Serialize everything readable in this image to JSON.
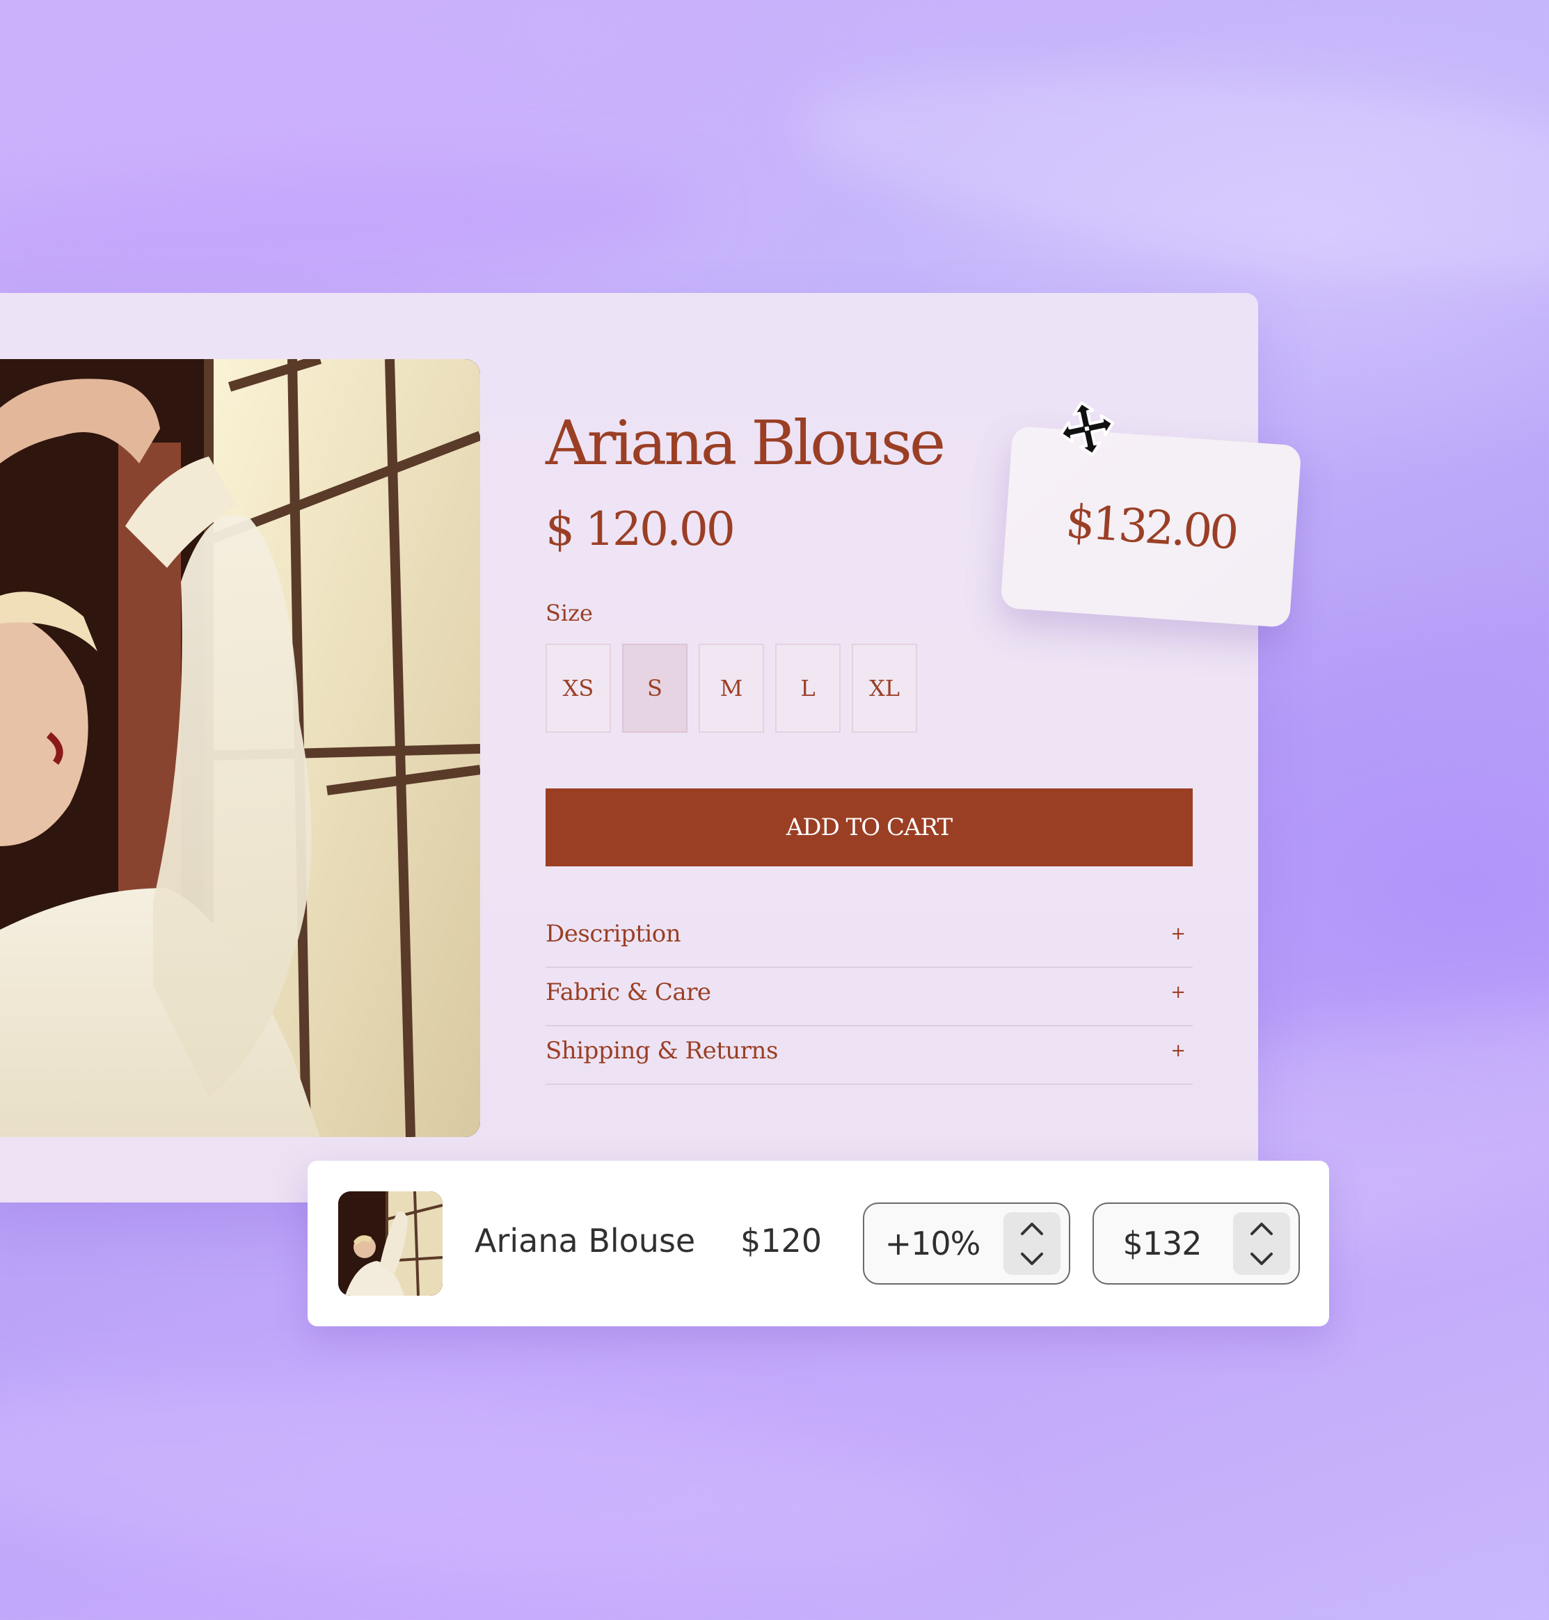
{
  "product": {
    "title": "Ariana Blouse",
    "price": "$ 120.00",
    "size_label": "Size",
    "sizes": [
      "XS",
      "S",
      "M",
      "L",
      "XL"
    ],
    "selected_size": "S",
    "add_to_cart_label": "ADD TO CART",
    "accordion": [
      {
        "label": "Description",
        "icon": "plus-icon",
        "toggle": "+"
      },
      {
        "label": "Fabric & Care",
        "icon": "plus-icon",
        "toggle": "+"
      },
      {
        "label": "Shipping & Returns",
        "icon": "plus-icon",
        "toggle": "+"
      }
    ]
  },
  "price_tag": {
    "value": "$132.00",
    "drag_icon": "move-icon"
  },
  "pricing_row": {
    "thumbnail_icon": "product-thumbnail",
    "name": "Ariana Blouse",
    "base_price": "$120",
    "markup": "+10%",
    "final_price": "$132",
    "stepper_icons": [
      "chevron-up-icon",
      "chevron-down-icon"
    ]
  },
  "colors": {
    "accent": "#9b3f24",
    "card_bg": "#eee4f4",
    "background": "#c6b0fa"
  }
}
